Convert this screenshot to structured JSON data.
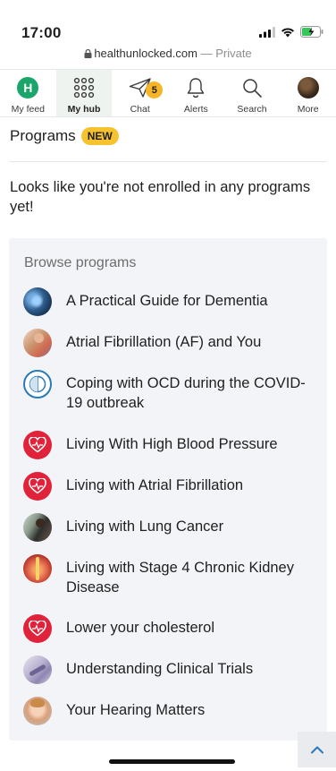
{
  "status_bar": {
    "time": "17:00"
  },
  "browser": {
    "domain": "healthunlocked.com",
    "separator": " — ",
    "private_label": "Private"
  },
  "nav": [
    {
      "label": "My feed",
      "avatar_letter": "H",
      "icon": "avatar-icon"
    },
    {
      "label": "My hub",
      "icon": "grid-icon",
      "active": true
    },
    {
      "label": "Chat",
      "icon": "paper-plane-icon",
      "badge": "5"
    },
    {
      "label": "Alerts",
      "icon": "bell-icon"
    },
    {
      "label": "Search",
      "icon": "search-icon"
    },
    {
      "label": "More",
      "icon": "profile-avatar-icon"
    }
  ],
  "programs": {
    "title": "Programs",
    "badge": "NEW",
    "empty_message": "Looks like you're not enrolled in any programs yet!",
    "browse_title": "Browse programs",
    "items": [
      {
        "label": "A Practical Guide for Dementia",
        "icon": "dementia-thumbnail"
      },
      {
        "label": "Atrial Fibrillation (AF) and You",
        "icon": "af-thumbnail"
      },
      {
        "label": "Coping with OCD during the COVID-19 outbreak",
        "icon": "ocd-thumbnail"
      },
      {
        "label": "Living With High Blood Pressure",
        "icon": "heart-icon"
      },
      {
        "label": "Living with Atrial Fibrillation",
        "icon": "heart-icon"
      },
      {
        "label": "Living with Lung Cancer",
        "icon": "lung-cancer-thumbnail"
      },
      {
        "label": "Living with Stage 4 Chronic Kidney Disease",
        "icon": "kidney-thumbnail"
      },
      {
        "label": "Lower your cholesterol",
        "icon": "heart-icon"
      },
      {
        "label": "Understanding Clinical Trials",
        "icon": "clinical-trials-thumbnail"
      },
      {
        "label": "Your Hearing Matters",
        "icon": "hearing-thumbnail"
      }
    ]
  },
  "colors": {
    "accent_green": "#1aa56a",
    "badge_yellow": "#f6c230",
    "heart_red": "#e0233b",
    "panel_bg": "#f3f4f8"
  }
}
